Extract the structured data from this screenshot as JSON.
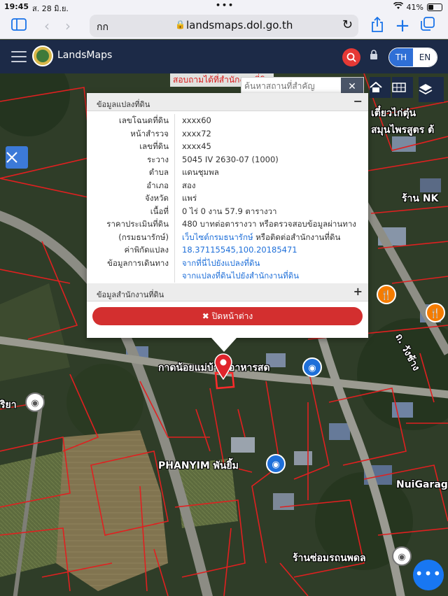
{
  "status_bar": {
    "time": "19:45",
    "date": "ส. 28 มิ.ย.",
    "battery": "41%",
    "dots": "•••"
  },
  "browser": {
    "reader_label": "กก",
    "url": "landsmaps.dol.go.th"
  },
  "app": {
    "brand": "LandsMaps",
    "lang_th": "TH",
    "lang_en": "EN"
  },
  "map": {
    "search_placeholder": "ค้นหาสถานที่สำคัญ",
    "top_notice": "สอบถามได้ที่สำนักงานที่ดิน",
    "labels": {
      "market": "กาดน้อยแม่บ้าน อาหารสด",
      "phanyim": "PHANYIM พันยิ้ม",
      "repair_shop": "ร้านซ่อมรถนพดล",
      "nuigarage": "NuiGarage",
      "chicken": "เตี๋ยวไก่ตุ๋น",
      "herb": "สมุนไพรสูตร ต้",
      "shop_nk": "ร้าน NK",
      "road": "ถ. วังช้าง",
      "left_label": "ริยา"
    }
  },
  "parcel": {
    "header": "ข้อมูลแปลงที่ดิน",
    "rows": [
      {
        "label": "เลขโฉนดที่ดิน",
        "value": "xxxx60"
      },
      {
        "label": "หน้าสำรวจ",
        "value": "xxxx72"
      },
      {
        "label": "เลขที่ดิน",
        "value": "xxxx45"
      },
      {
        "label": "ระวาง",
        "value": "5045 IV 2630-07 (1000)"
      },
      {
        "label": "ตำบล",
        "value": "แดนชุมพล"
      },
      {
        "label": "อำเภอ",
        "value": "สอง"
      },
      {
        "label": "จังหวัด",
        "value": "แพร่"
      },
      {
        "label": "เนื้อที่",
        "value": "0 ไร่ 0 งาน 57.9 ตารางวา"
      },
      {
        "label": "ราคาประเมินที่ดิน",
        "value": "480 บาทต่อตารางวา หรือตรวจสอบข้อมูลผ่านทาง"
      }
    ],
    "treasury_label": "(กรมธนารักษ์)",
    "treasury_link": "เว็บไซต์กรมธนารักษ์",
    "treasury_suffix": " หรือติดต่อสำนักงานที่ดิน",
    "coord_label": "ค่าพิกัดแปลง",
    "coord_value": "18.37115545,100.20185471",
    "travel_label": "ข้อมูลการเดินทาง",
    "travel_link_1": "จากที่นี่ไปยังแปลงที่ดิน",
    "travel_link_2": "จากแปลงที่ดินไปยังสำนักงานที่ดิน",
    "office_header": "ข้อมูลสำนักงานที่ดิน",
    "close_label": "✖ ปิดหน้าต่าง"
  }
}
